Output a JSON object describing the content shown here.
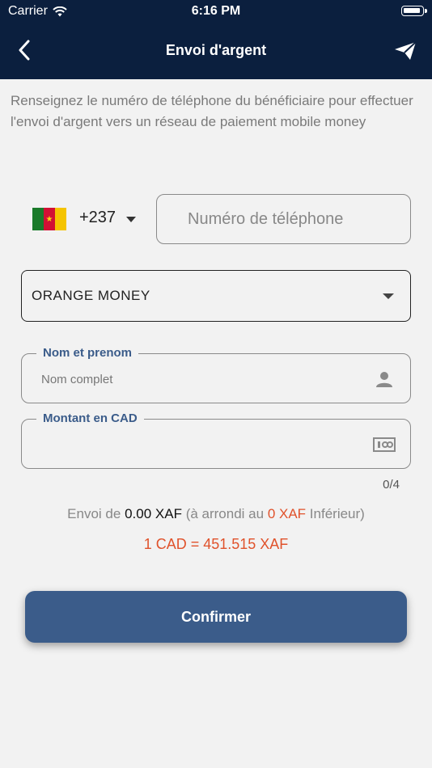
{
  "status_bar": {
    "carrier": "Carrier",
    "time": "6:16 PM"
  },
  "nav": {
    "title": "Envoi d'argent",
    "back_icon": "chevron-left-icon",
    "send_icon": "paper-plane-icon"
  },
  "intro_text": "Renseignez le numéro de téléphone du bénéficiaire pour effectuer l'envoi d'argent vers un réseau de paiement mobile money",
  "phone": {
    "flag_icon": "cameroon-flag-icon",
    "dial_code": "+237",
    "placeholder": "Numéro de téléphone",
    "value": ""
  },
  "network_select": {
    "selected": "ORANGE MONEY"
  },
  "name_field": {
    "label": "Nom et prenom",
    "placeholder": "Nom complet",
    "value": "",
    "icon": "person-icon"
  },
  "amount_field": {
    "label": "Montant en CAD",
    "placeholder": "",
    "value": "",
    "icon": "banknote-icon",
    "counter": "0/4"
  },
  "summary": {
    "prefix": "Envoi de",
    "amount": "0.00 XAF",
    "middle": "(à arrondi au",
    "rounded": "0 XAF",
    "suffix": "Inférieur)"
  },
  "rate": "1 CAD = 451.515 XAF",
  "confirm_label": "Confirmer",
  "colors": {
    "header_bg": "#0b1f3e",
    "accent": "#3b5c8a",
    "highlight": "#e0522b",
    "background": "#f2f2f2"
  }
}
